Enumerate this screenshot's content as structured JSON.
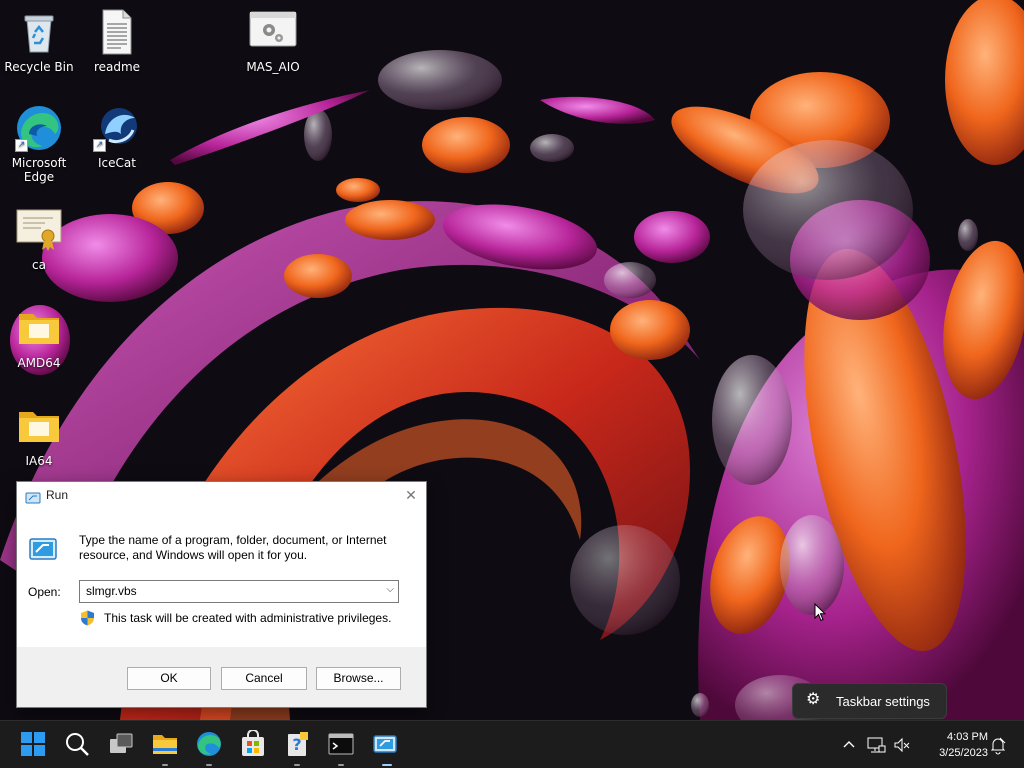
{
  "desktop": {
    "icons": [
      {
        "label": "Recycle Bin",
        "icon": "recycle-bin-icon"
      },
      {
        "label": "readme",
        "icon": "text-document-icon"
      },
      {
        "label": "MAS_AIO",
        "icon": "script-file-icon"
      },
      {
        "label": "Microsoft\nEdge",
        "icon": "edge-icon"
      },
      {
        "label": "IceCat",
        "icon": "icecat-icon"
      },
      {
        "label": "ca",
        "icon": "certificate-icon"
      },
      {
        "label": "AMD64",
        "icon": "folder-icon"
      },
      {
        "label": "IA64",
        "icon": "folder-icon"
      }
    ]
  },
  "run_dialog": {
    "title": "Run",
    "description": "Type the name of a program, folder, document, or Internet resource, and Windows will open it for you.",
    "open_label": "Open:",
    "input_value": "slmgr.vbs",
    "admin_note": "This task will be created with administrative privileges.",
    "buttons": {
      "ok": "OK",
      "cancel": "Cancel",
      "browse": "Browse..."
    }
  },
  "tooltip": {
    "text": "Taskbar settings"
  },
  "taskbar": {
    "apps": [
      "start-icon",
      "search-icon",
      "task-view-icon",
      "file-explorer-icon",
      "edge-icon",
      "store-icon",
      "help-icon",
      "terminal-icon",
      "run-icon"
    ],
    "clock": {
      "time": "4:03 PM",
      "date": "3/25/2023"
    }
  },
  "colors": {
    "taskbar": "#1c1c1c",
    "accent": "#0078d4",
    "dialog_footer": "#f0f0f0"
  }
}
